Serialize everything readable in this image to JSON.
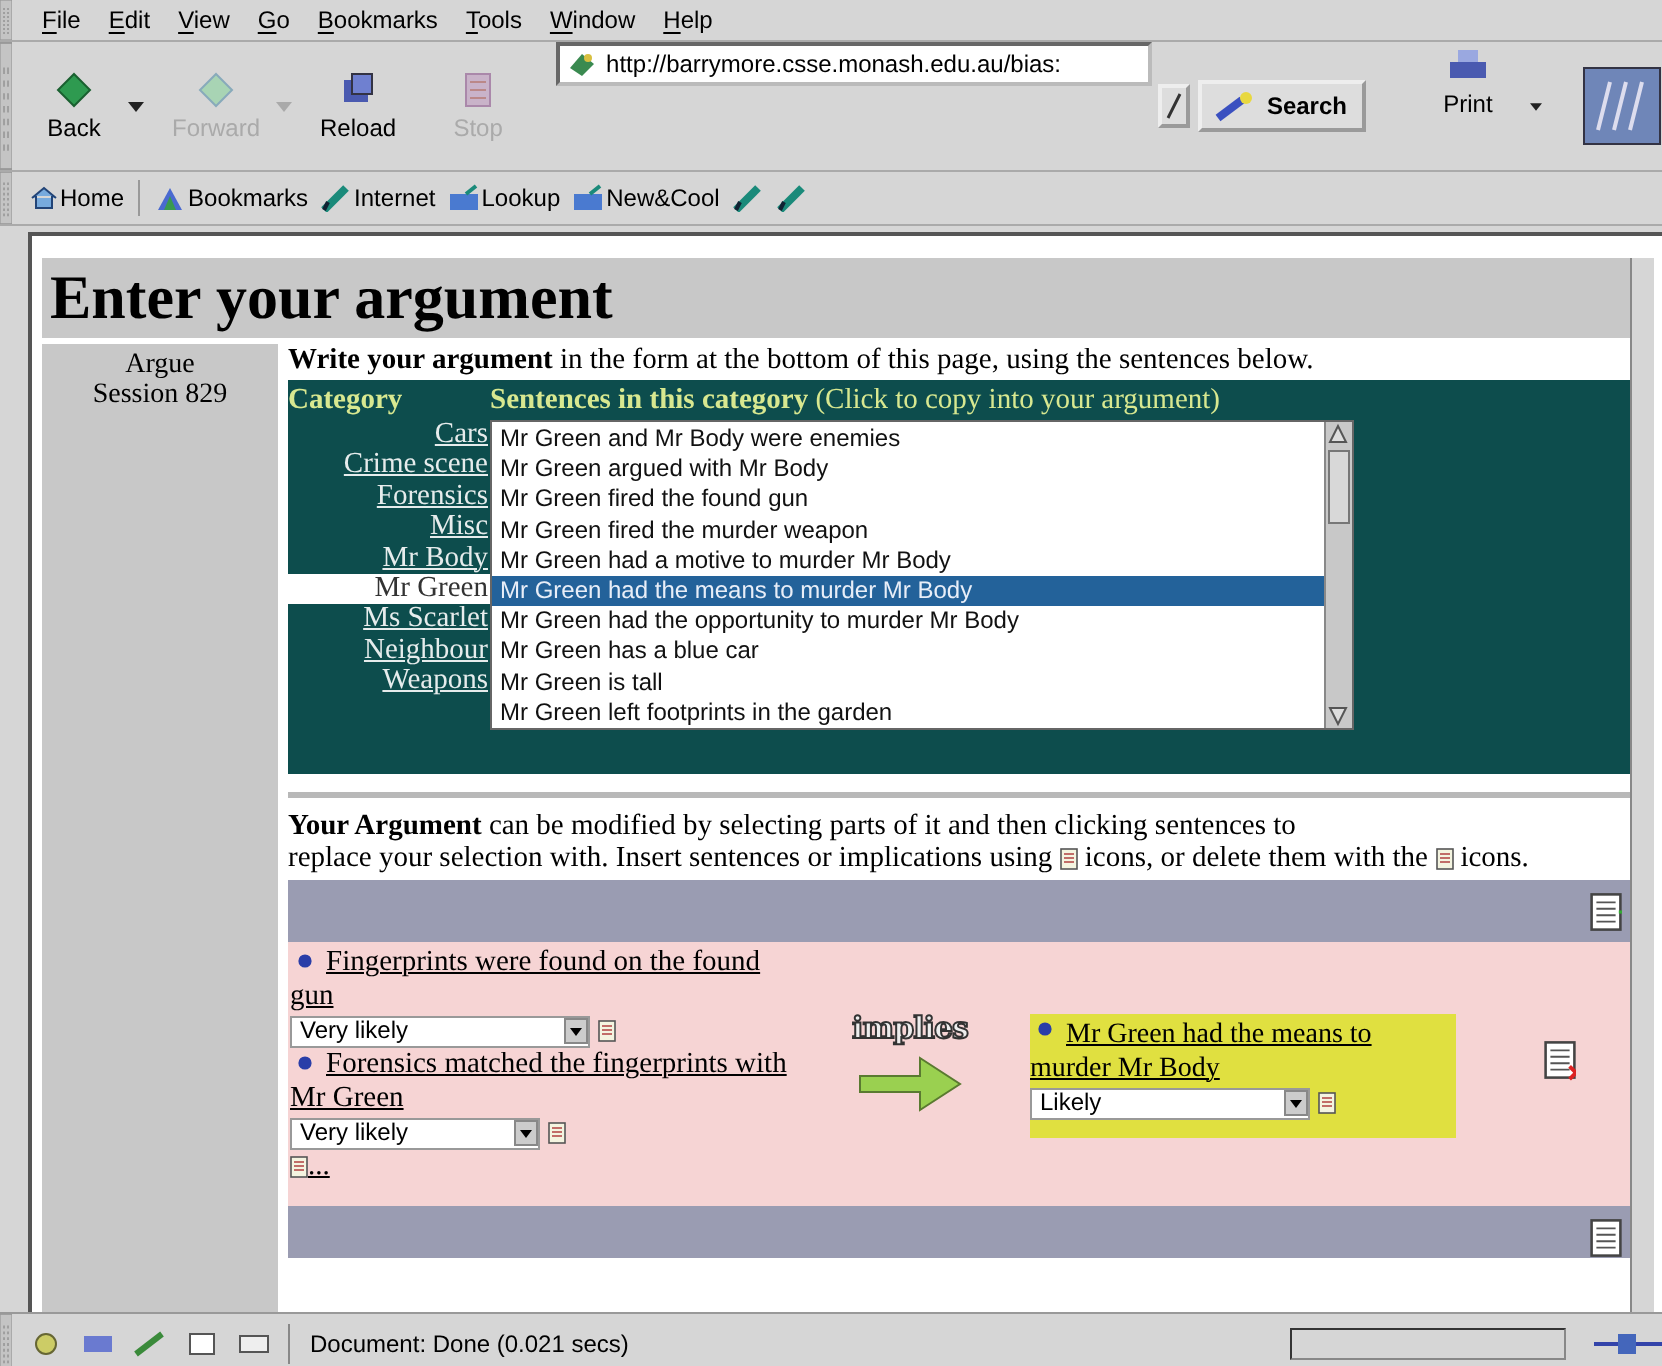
{
  "menu": [
    "File",
    "Edit",
    "View",
    "Go",
    "Bookmarks",
    "Tools",
    "Window",
    "Help"
  ],
  "toolbar": [
    {
      "label": "Back",
      "kind": "back",
      "disabled": false,
      "dropdown": true
    },
    {
      "label": "Forward",
      "kind": "forward",
      "disabled": true,
      "dropdown": true
    },
    {
      "label": "Reload",
      "kind": "reload",
      "disabled": false,
      "dropdown": false
    },
    {
      "label": "Stop",
      "kind": "stop",
      "disabled": true,
      "dropdown": false
    }
  ],
  "address": {
    "value": "http://barrymore.csse.monash.edu.au/bias:"
  },
  "search_button": "Search",
  "print_button": "Print",
  "personal_toolbar": [
    {
      "label": "Home",
      "kind": "home"
    },
    {
      "label": "Bookmarks",
      "kind": "bookmarks"
    },
    {
      "label": "Internet",
      "kind": "link"
    },
    {
      "label": "Lookup",
      "kind": "folder"
    },
    {
      "label": "New&Cool",
      "kind": "folder"
    },
    {
      "kind": "link"
    },
    {
      "kind": "link"
    }
  ],
  "page": {
    "title": "Enter your argument",
    "sidebar": [
      "Argue",
      "Session 829"
    ],
    "intro": "**Write your argument** in the form at the bottom of this page, using the sentences below.",
    "category_header": "Category",
    "sentences_header": "**Sentences in this category** (Click to copy into your argument)",
    "categories": [
      {
        "label": "Cars",
        "selected": false
      },
      {
        "label": "Crime scene",
        "selected": false
      },
      {
        "label": "Forensics",
        "selected": false
      },
      {
        "label": "Misc",
        "selected": false
      },
      {
        "label": "Mr Body",
        "selected": false
      },
      {
        "label": "Mr Green",
        "selected": true
      },
      {
        "label": "Ms Scarlet",
        "selected": false
      },
      {
        "label": "Neighbour",
        "selected": false
      },
      {
        "label": "Weapons",
        "selected": false
      }
    ],
    "sentences": [
      {
        "text": "Mr Green and Mr Body were enemies",
        "selected": false
      },
      {
        "text": "Mr Green argued with Mr Body",
        "selected": false
      },
      {
        "text": "Mr Green fired the found gun",
        "selected": false
      },
      {
        "text": "Mr Green fired the murder weapon",
        "selected": false
      },
      {
        "text": "Mr Green had a motive to murder Mr Body",
        "selected": false
      },
      {
        "text": "Mr Green had the means to murder Mr Body",
        "selected": true
      },
      {
        "text": "Mr Green had the opportunity to murder Mr Body",
        "selected": false
      },
      {
        "text": "Mr Green has a blue car",
        "selected": false
      },
      {
        "text": "Mr Green is tall",
        "selected": false
      },
      {
        "text": "Mr Green left footprints in the garden",
        "selected": false
      }
    ],
    "argument_help": [
      "**Your Argument** can be modified by selecting parts of it and then clicking sentences to",
      "replace your selection with. Insert sentences or implications using",
      "icons, or delete them",
      "with the",
      "icons."
    ],
    "premises": [
      {
        "text": "Fingerprints were found on the found gun",
        "likelihood": "Very likely"
      },
      {
        "text": "Forensics matched the fingerprints with Mr Green",
        "likelihood": "Very likely"
      }
    ],
    "more_link": "...",
    "connector": "implies",
    "conclusion": {
      "text": "Mr Green had the means to murder Mr Body",
      "likelihood": "Likely"
    }
  },
  "status": "Document: Done (0.021 secs)"
}
